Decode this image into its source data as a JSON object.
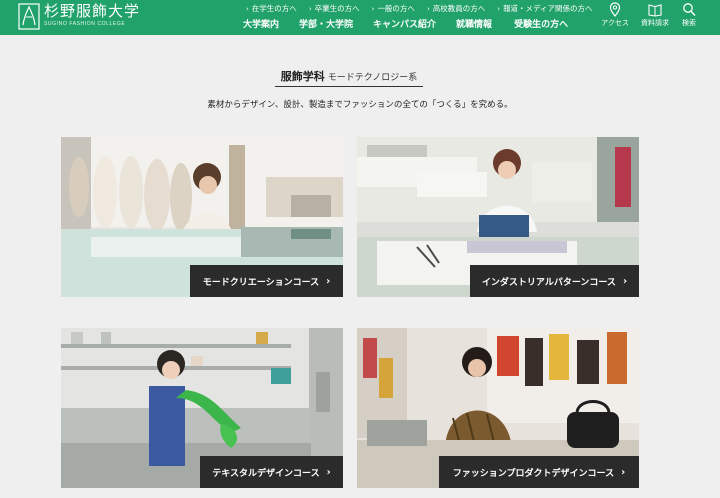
{
  "header": {
    "logo_text": "杉野服飾大学",
    "logo_sub": "SUGINO FASHION COLLEGE",
    "top_links": [
      "在学生の方へ",
      "卒業生の方へ",
      "一般の方へ",
      "高校教員の方へ",
      "報道・メディア関係の方へ"
    ],
    "main_nav": [
      "大学案内",
      "学部・大学院",
      "キャンパス紹介",
      "就職情報",
      "受験生の方へ"
    ],
    "utilities": {
      "access": {
        "label": "アクセス",
        "icon": "map-pin-icon"
      },
      "brochure": {
        "label": "資料請求",
        "icon": "book-icon"
      },
      "search": {
        "label": "検索",
        "icon": "search-icon"
      }
    },
    "colors": {
      "brand": "#21a26a"
    }
  },
  "page": {
    "title": "服飾学科",
    "subtitle": "モードテクノロジー系",
    "lead": "素材からデザイン、設計、製造までファッションの全ての「つくる」を究める。"
  },
  "courses": [
    {
      "label": "モードクリエーションコース",
      "arrow": "›"
    },
    {
      "label": "インダストリアルパターンコース",
      "arrow": "›"
    },
    {
      "label": "テキスタルデザインコース",
      "arrow": "›"
    },
    {
      "label": "ファッションプロダクトデザインコース",
      "arrow": "›"
    }
  ]
}
